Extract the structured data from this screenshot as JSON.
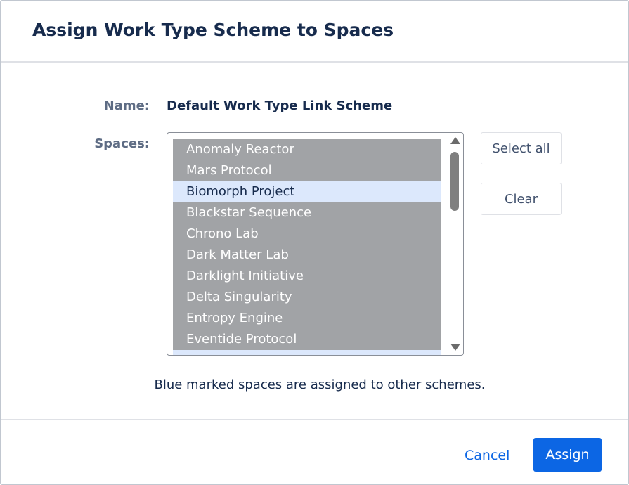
{
  "dialog": {
    "title": "Assign Work Type Scheme to Spaces"
  },
  "form": {
    "name_label": "Name:",
    "name_value": "Default Work Type Link Scheme",
    "spaces_label": "Spaces:",
    "spaces": [
      {
        "label": "Anomaly Reactor",
        "assigned_elsewhere": false
      },
      {
        "label": "Mars Protocol",
        "assigned_elsewhere": false
      },
      {
        "label": "Biomorph Project",
        "assigned_elsewhere": true
      },
      {
        "label": "Blackstar Sequence",
        "assigned_elsewhere": false
      },
      {
        "label": "Chrono Lab",
        "assigned_elsewhere": false
      },
      {
        "label": "Dark Matter Lab",
        "assigned_elsewhere": false
      },
      {
        "label": "Darklight Initiative",
        "assigned_elsewhere": false
      },
      {
        "label": "Delta Singularity",
        "assigned_elsewhere": false
      },
      {
        "label": "Entropy Engine",
        "assigned_elsewhere": false
      },
      {
        "label": "Eventide Protocol",
        "assigned_elsewhere": false
      },
      {
        "label": "",
        "assigned_elsewhere": true
      }
    ],
    "select_all_label": "Select all",
    "clear_label": "Clear",
    "hint": "Blue marked spaces are assigned to other schemes."
  },
  "footer": {
    "cancel_label": "Cancel",
    "assign_label": "Assign"
  },
  "colors": {
    "selected_item": "#a1a3a6",
    "assigned_item": "#dce8fc",
    "primary": "#0c66e4"
  },
  "icons": {
    "scroll_up": "triangle-up",
    "scroll_down": "triangle-down"
  }
}
